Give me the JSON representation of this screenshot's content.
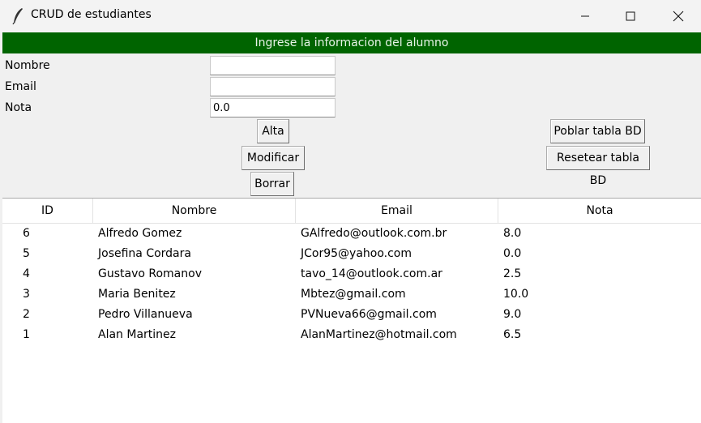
{
  "window": {
    "title": "CRUD de estudiantes",
    "icon": "feather-icon"
  },
  "header": {
    "text": "Ingrese la informacion del alumno",
    "bg_color": "#006400"
  },
  "form": {
    "nombre_label": "Nombre",
    "nombre_value": "",
    "email_label": "Email",
    "email_value": "",
    "nota_label": "Nota",
    "nota_value": "0.0"
  },
  "buttons": {
    "alta": "Alta",
    "modificar": "Modificar",
    "borrar": "Borrar",
    "poblar": "Poblar tabla BD",
    "resetear": "Resetear tabla BD"
  },
  "table": {
    "headers": [
      "ID",
      "Nombre",
      "Email",
      "Nota"
    ],
    "rows": [
      [
        "6",
        "Alfredo Gomez",
        "GAlfredo@outlook.com.br",
        "8.0"
      ],
      [
        "5",
        "Josefina Cordara",
        "JCor95@yahoo.com",
        "0.0"
      ],
      [
        "4",
        "Gustavo Romanov",
        "tavo_14@outlook.com.ar",
        "2.5"
      ],
      [
        "3",
        "Maria Benitez",
        "Mbtez@gmail.com",
        "10.0"
      ],
      [
        "2",
        "Pedro Villanueva",
        "PVNueva66@gmail.com",
        "9.0"
      ],
      [
        "1",
        "Alan Martinez",
        "AlanMartinez@hotmail.com",
        "6.5"
      ]
    ]
  }
}
